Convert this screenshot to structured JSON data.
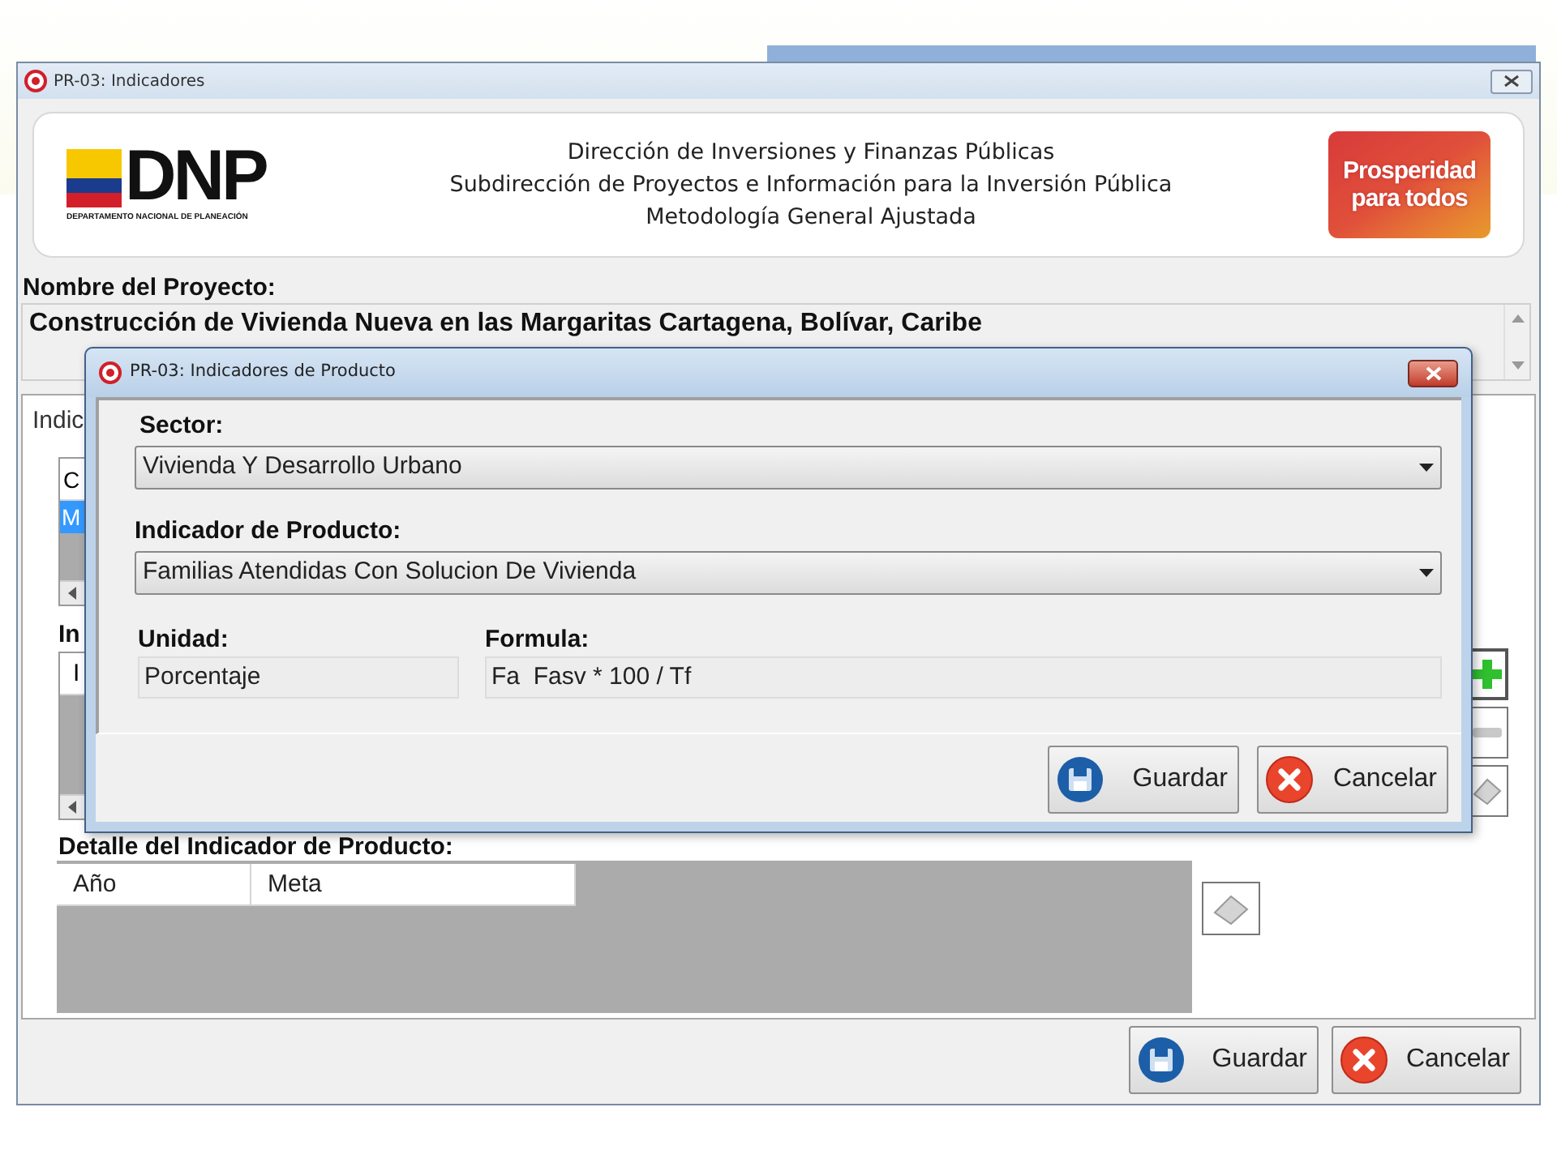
{
  "main_window": {
    "title": "PR-03: Indicadores",
    "header": {
      "logo_text": "DNP",
      "logo_caption": "DEPARTAMENTO NACIONAL DE PLANEACIÓN",
      "lines": [
        "Dirección de Inversiones y Finanzas Públicas",
        "Subdirección de Proyectos e Información para la Inversión Pública",
        "Metodología General Ajustada"
      ],
      "slogan": [
        "Prosperidad",
        "para todos"
      ]
    },
    "project": {
      "label": "Nombre del Proyecto:",
      "value": "Construcción de Vivienda Nueva en las Margaritas Cartagena, Bolívar, Caribe"
    },
    "tab_label": "Indic",
    "list_1": {
      "column_1": "C",
      "rows": [
        {
          "cell_1": "M",
          "selected": true
        }
      ]
    },
    "section_label": "In",
    "list_2": {
      "column_1": "I"
    },
    "detail": {
      "label": "Detalle del Indicador de Producto:",
      "columns": [
        "Año",
        "Meta"
      ]
    },
    "buttons": [
      {
        "label": "Guardar",
        "kind": "save"
      },
      {
        "label": "Cancelar",
        "kind": "cancel"
      }
    ]
  },
  "dialog": {
    "title": "PR-03: Indicadores de Producto",
    "dropdowns": [
      {
        "label": "Sector:",
        "value": "Vivienda Y Desarrollo Urbano"
      },
      {
        "label": "Indicador de Producto:",
        "value": "Familias Atendidas Con Solucion De Vivienda"
      }
    ],
    "readonly_fields": [
      {
        "label": "Unidad:",
        "value": "Porcentaje"
      },
      {
        "label": "Formula:",
        "value": "Fa  Fasv * 100 / Tf"
      }
    ],
    "buttons": [
      {
        "label": "Guardar",
        "kind": "save"
      },
      {
        "label": "Cancelar",
        "kind": "cancel"
      }
    ]
  }
}
